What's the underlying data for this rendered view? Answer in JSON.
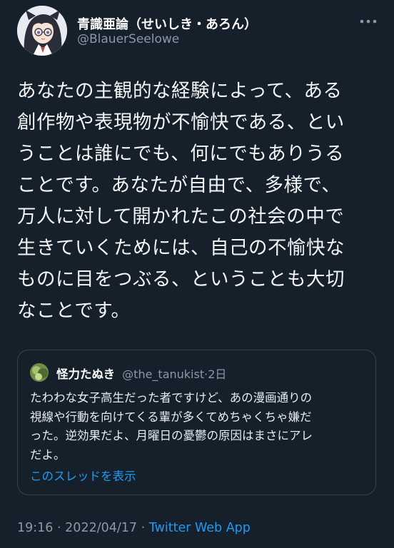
{
  "author": {
    "name": "青識亜論（せいしき・あろん）",
    "handle": "@BlauerSeelowe"
  },
  "tweet": {
    "lines": [
      "あなたの主観的な経験によって、ある",
      "創作物や表現物が不愉快である、とい",
      "うことは誰にでも、何にでもありうる",
      "ことです。あなたが自由で、多様で、",
      "万人に対して開かれたこの社会の中で",
      "生きていくためには、自己の不愉快な",
      "ものに目をつぶる、ということも大切",
      "なことです。"
    ]
  },
  "quote": {
    "name": "怪力たぬき",
    "handle": "@the_tanukist",
    "separator": "·",
    "age": "2日",
    "lines": [
      "たわわな女子高生だった者ですけど、あの漫画通りの",
      "視線や行動を向けてくる輩が多くてめちゃくちゃ嫌だ",
      "った。逆効果だよ、月曜日の憂鬱の原因はまさにアレ",
      "だよ。"
    ],
    "thread_link": "このスレッドを表示"
  },
  "meta": {
    "time": "19:16",
    "separator": "·",
    "date": "2022/04/17",
    "source": "Twitter Web App"
  },
  "colors": {
    "background": "#15202b",
    "link": "#1d9bf0",
    "secondary_text": "#8b98a5",
    "border": "#38444d"
  },
  "icons": {
    "more": "more-horizontal-icon"
  }
}
